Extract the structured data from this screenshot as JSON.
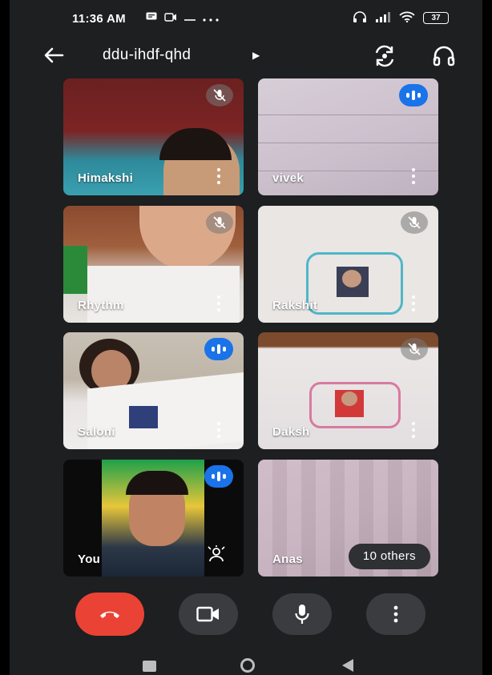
{
  "status_bar": {
    "time": "11:36 AM",
    "battery": "37"
  },
  "header": {
    "meeting_code": "ddu-ihdf-qhd"
  },
  "participants": [
    {
      "name": "Himakshi",
      "state": "muted"
    },
    {
      "name": "vivek",
      "state": "speaking"
    },
    {
      "name": "Rhythm",
      "state": "muted"
    },
    {
      "name": "Rakshit",
      "state": "muted"
    },
    {
      "name": "Saloni",
      "state": "speaking"
    },
    {
      "name": "Daksh",
      "state": "muted"
    },
    {
      "name": "You",
      "state": "speaking"
    },
    {
      "name": "Anas",
      "state": "none"
    }
  ],
  "others_label": "10 others",
  "colors": {
    "end_call": "#ea4335",
    "speaking_badge": "#1a73e8",
    "control_bg": "#3a3c3f"
  }
}
